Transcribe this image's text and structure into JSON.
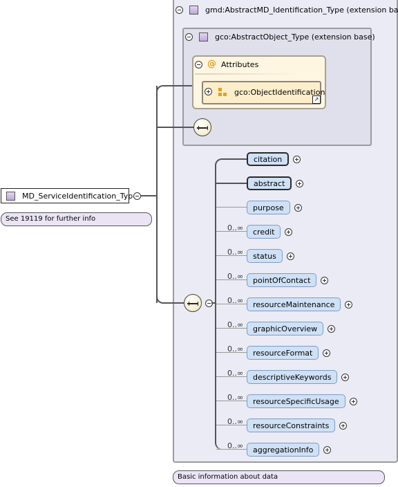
{
  "root": {
    "name": "MD_ServiceIdentification_Type",
    "doc": "See 19119 for further info"
  },
  "outer_ext": {
    "label": "gmd:AbstractMD_Identification_Type (extension base)",
    "doc": "Basic information about data"
  },
  "inner_ext": {
    "label": "gco:AbstractObject_Type (extension base)"
  },
  "attributes": {
    "label": "Attributes",
    "group_ref": "gco:ObjectIdentification"
  },
  "elements": [
    {
      "name": "citation",
      "cardinality": "",
      "required": true
    },
    {
      "name": "abstract",
      "cardinality": "",
      "required": true
    },
    {
      "name": "purpose",
      "cardinality": "",
      "required": false
    },
    {
      "name": "credit",
      "cardinality": "0..∞",
      "required": false
    },
    {
      "name": "status",
      "cardinality": "0..∞",
      "required": false
    },
    {
      "name": "pointOfContact",
      "cardinality": "0..∞",
      "required": false
    },
    {
      "name": "resourceMaintenance",
      "cardinality": "0..∞",
      "required": false
    },
    {
      "name": "graphicOverview",
      "cardinality": "0..∞",
      "required": false
    },
    {
      "name": "resourceFormat",
      "cardinality": "0..∞",
      "required": false
    },
    {
      "name": "descriptiveKeywords",
      "cardinality": "0..∞",
      "required": false
    },
    {
      "name": "resourceSpecificUsage",
      "cardinality": "0..∞",
      "required": false
    },
    {
      "name": "resourceConstraints",
      "cardinality": "0..∞",
      "required": false
    },
    {
      "name": "aggregationInfo",
      "cardinality": "0..∞",
      "required": false
    }
  ],
  "icons": {
    "collapse": "minus-circle-icon",
    "expand": "plus-circle-icon",
    "type": "complex-type-icon",
    "sequence": "sequence-compositor-icon",
    "attribute": "at-sign-icon",
    "attribute_group": "attribute-group-icon",
    "shortcut": "shortcut-arrow-icon"
  }
}
